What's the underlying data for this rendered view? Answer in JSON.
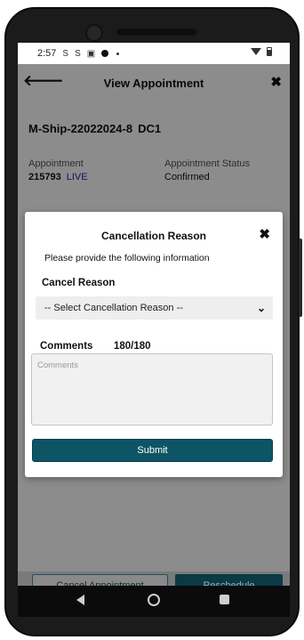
{
  "status_bar": {
    "time": "2:57",
    "icons": [
      "s-icon",
      "s-icon",
      "teams-icon",
      "notification-dot",
      "small-dot",
      "wifi-icon",
      "battery-icon"
    ],
    "icon_glyph_s": "S"
  },
  "app_bar": {
    "back_glyph": "🡐",
    "title": "View Appointment",
    "close_glyph": "✖"
  },
  "appointment": {
    "ship_id": "M-Ship-22022024-8",
    "location": "DC1",
    "appointment_label": "Appointment",
    "appointment_number": "215793",
    "live_tag": "LIVE",
    "status_label": "Appointment Status",
    "status_value": "Confirmed"
  },
  "dialog": {
    "title": "Cancellation Reason",
    "close_glyph": "✖",
    "instruction": "Please provide the following information",
    "cancel_reason_label": "Cancel Reason",
    "select_value": "-- Select Cancellation Reason --",
    "chevron_glyph": "⌄",
    "comments_label": "Comments",
    "comments_counter": "180/180",
    "comments_placeholder": "Comments",
    "submit_label": "Submit"
  },
  "bottom_actions": {
    "cancel_label": "Cancel Appointment",
    "reschedule_label": "Reschedule"
  },
  "colors": {
    "primary": "#0d5565",
    "dark_primary": "#0a3a45",
    "live": "#2222aa",
    "overlay": "rgba(0,0,0,0.45)"
  }
}
